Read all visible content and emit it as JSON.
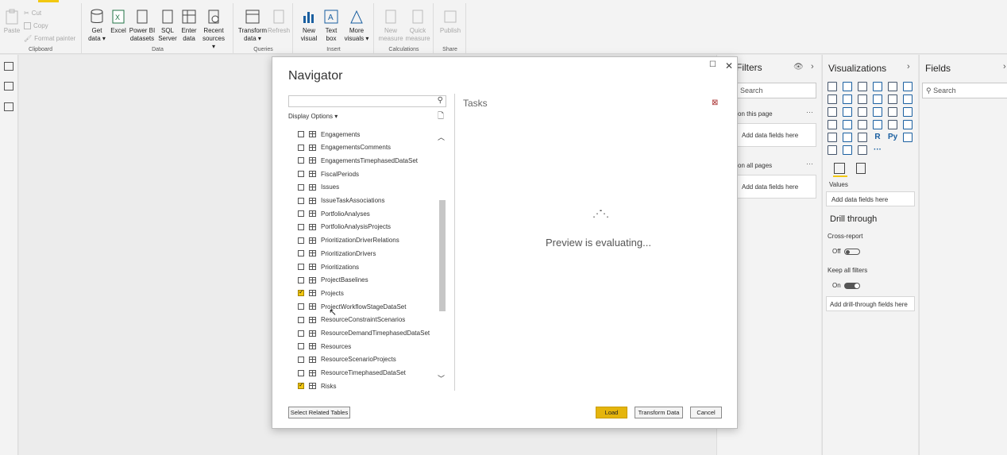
{
  "ribbon": {
    "clipboard": {
      "paste": "Paste",
      "cut": "Cut",
      "copy": "Copy",
      "format_painter": "Format painter",
      "label": "Clipboard"
    },
    "data": {
      "get_data": "Get data",
      "excel": "Excel",
      "power_bi": "Power BI datasets",
      "sql": "SQL Server",
      "enter_data": "Enter data",
      "recent": "Recent sources",
      "label": "Data"
    },
    "queries": {
      "transform": "Transform data",
      "refresh": "Refresh",
      "label": "Queries"
    },
    "insert": {
      "new_visual": "New visual",
      "text_box": "Text box",
      "more_visuals": "More visuals",
      "label": "Insert"
    },
    "calculations": {
      "new_measure": "New measure",
      "quick_measure": "Quick measure",
      "label": "Calculations"
    },
    "share": {
      "publish": "Publish",
      "label": "Share"
    }
  },
  "filters": {
    "title": "Filters",
    "search_placeholder": "Search",
    "on_this_page": "on this page",
    "on_all_pages": "on all pages",
    "add_fields": "Add data fields here"
  },
  "visualizations": {
    "title": "Visualizations",
    "r_label": "R",
    "py_label": "Py",
    "values_label": "Values",
    "add_fields": "Add data fields here",
    "drill_through": "Drill through",
    "cross_report": "Cross-report",
    "off": "Off",
    "keep_filters": "Keep all filters",
    "on": "On",
    "add_drill": "Add drill-through fields here"
  },
  "fields": {
    "title": "Fields",
    "search_placeholder": "Search"
  },
  "navigator": {
    "title": "Navigator",
    "display_options": "Display Options",
    "tasks": "Tasks",
    "preview_text": "Preview is evaluating...",
    "items": [
      {
        "label": "Engagements",
        "checked": false
      },
      {
        "label": "EngagementsComments",
        "checked": false
      },
      {
        "label": "EngagementsTimephasedDataSet",
        "checked": false
      },
      {
        "label": "FiscalPeriods",
        "checked": false
      },
      {
        "label": "Issues",
        "checked": false
      },
      {
        "label": "IssueTaskAssociations",
        "checked": false
      },
      {
        "label": "PortfolioAnalyses",
        "checked": false
      },
      {
        "label": "PortfolioAnalysisProjects",
        "checked": false
      },
      {
        "label": "PrioritizationDriverRelations",
        "checked": false
      },
      {
        "label": "PrioritizationDrivers",
        "checked": false
      },
      {
        "label": "Prioritizations",
        "checked": false
      },
      {
        "label": "ProjectBaselines",
        "checked": false
      },
      {
        "label": "Projects",
        "checked": true
      },
      {
        "label": "ProjectWorkflowStageDataSet",
        "checked": false
      },
      {
        "label": "ResourceConstraintScenarios",
        "checked": false
      },
      {
        "label": "ResourceDemandTimephasedDataSet",
        "checked": false
      },
      {
        "label": "Resources",
        "checked": false
      },
      {
        "label": "ResourceScenarioProjects",
        "checked": false
      },
      {
        "label": "ResourceTimephasedDataSet",
        "checked": false
      },
      {
        "label": "Risks",
        "checked": true
      }
    ],
    "select_related": "Select Related Tables",
    "load": "Load",
    "transform": "Transform Data",
    "cancel": "Cancel"
  },
  "colors": {
    "accent": "#f2c811",
    "load_button": "#e5b50c"
  }
}
